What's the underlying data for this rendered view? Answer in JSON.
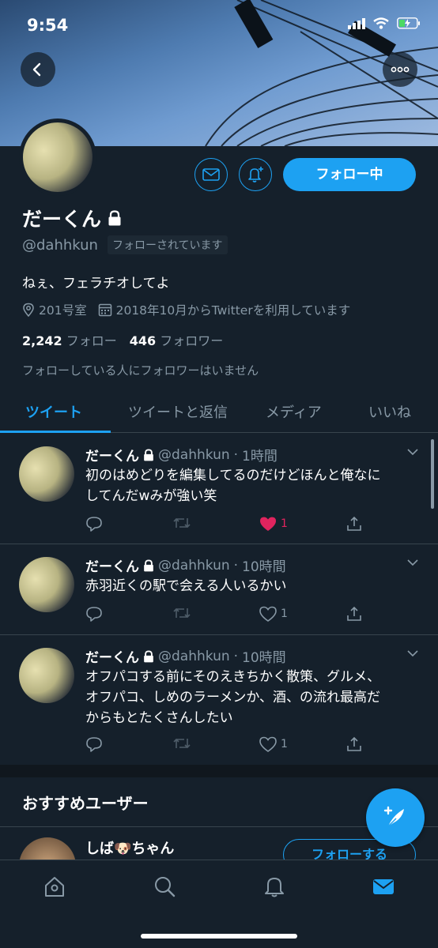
{
  "status_bar": {
    "time": "9:54"
  },
  "profile": {
    "name": "だーくん",
    "handle": "@dahhkun",
    "follows_you": "フォローされています",
    "bio": "ねぇ、フェラチオしてよ",
    "location": "201号室",
    "joined": "2018年10月からTwitterを利用しています",
    "following_count": "2,242",
    "following_label": "フォロー",
    "followers_count": "446",
    "followers_label": "フォロワー",
    "known_followers": "フォローしている人にフォロワーはいません",
    "follow_button": "フォロー中"
  },
  "tabs": [
    "ツイート",
    "ツイートと返信",
    "メディア",
    "いいね"
  ],
  "tweets": [
    {
      "name": "だーくん",
      "handle": "@dahhkun",
      "time": "1時間",
      "text_lines": [
        "初のはめどりを編集してるのだけどほんと俺なに",
        "してんだwみが強い笑"
      ],
      "likes": "1",
      "liked": true
    },
    {
      "name": "だーくん",
      "handle": "@dahhkun",
      "time": "10時間",
      "text_lines": [
        "赤羽近くの駅で会える人いるかい"
      ],
      "likes": "1",
      "liked": false
    },
    {
      "name": "だーくん",
      "handle": "@dahhkun",
      "time": "10時間",
      "text_lines": [
        "オフパコする前にそのえきちかく散策、グルメ、",
        "オフパコ、しめのラーメンか、酒、の流れ最高だ",
        "からもとたくさんしたい"
      ],
      "likes": "1",
      "liked": false
    }
  ],
  "recommended": {
    "title": "おすすめユーザー",
    "user_name": "しば🐶ちゃん",
    "follow_button": "フォローする"
  },
  "colors": {
    "accent": "#1da1f2",
    "background": "#15202b",
    "like": "#e0245e",
    "muted": "#8899a6"
  }
}
